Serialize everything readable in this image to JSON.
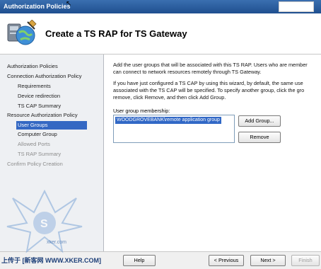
{
  "window": {
    "title": "Authorization Policies"
  },
  "header": {
    "heading": "Create a TS RAP for TS Gateway",
    "icon": "ts-gateway-globe-icon"
  },
  "sidebar": {
    "items": [
      {
        "label": "Authorization Policies",
        "state": "normal"
      },
      {
        "label": "Connection Authorization Policy",
        "state": "normal"
      },
      {
        "label": "Requirements",
        "state": "normal"
      },
      {
        "label": "Device redirection",
        "state": "normal"
      },
      {
        "label": "TS CAP Summary",
        "state": "normal"
      },
      {
        "label": "Resource Authorization Policy",
        "state": "normal"
      },
      {
        "label": "User Groups",
        "state": "active"
      },
      {
        "label": "Computer Group",
        "state": "normal"
      },
      {
        "label": "Allowed Ports",
        "state": "disabled"
      },
      {
        "label": "TS RAP Summary",
        "state": "disabled"
      },
      {
        "label": "Confirm Policy Creation",
        "state": "disabled"
      }
    ]
  },
  "main": {
    "para1_line1": "Add the user groups that will be associated with this TS RAP. Users who are member",
    "para1_line2": "can connect to network resources remotely through TS Gateway.",
    "para2_line1": "If you have just configured a TS CAP by using this wizard, by default, the same use",
    "para2_line2": "associated with the TS CAP will be specified. To specify another group, click the gro",
    "para2_line3": "remove, click Remove, and then click Add Group.",
    "list_label": "User group membership:",
    "groups": [
      "WOODGROVEBANK\\remote application group"
    ],
    "add_group": "Add Group...",
    "remove": "Remove"
  },
  "footer": {
    "help": "Help",
    "previous": "< Previous",
    "next": "Next >",
    "finish": "Finish"
  },
  "watermark": {
    "text": "上传于 [新客网 WWW.XKER.COM]",
    "url": "xker.com"
  },
  "colors": {
    "titlebar": "#1f4f8f",
    "selection": "#3468c3",
    "sidebar_bg": "#eef0f3"
  }
}
